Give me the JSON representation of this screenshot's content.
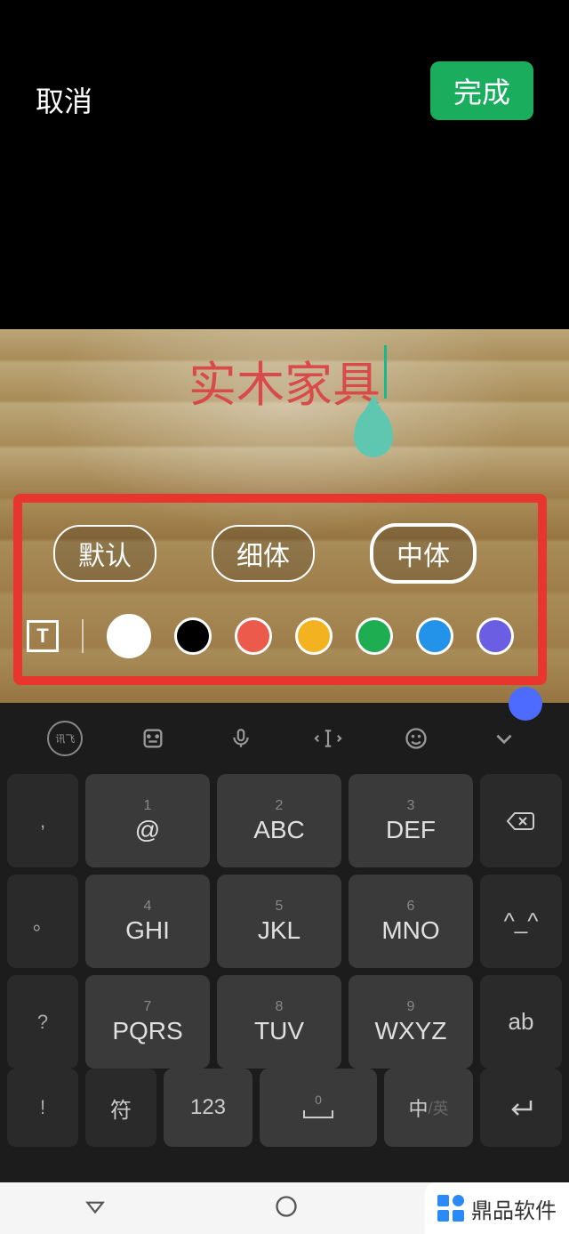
{
  "header": {
    "cancel": "取消",
    "done": "完成"
  },
  "canvas": {
    "text": "实木家具"
  },
  "fonts": {
    "default": "默认",
    "thin": "细体",
    "medium": "中体"
  },
  "colors": [
    {
      "name": "white",
      "hex": "#ffffff",
      "selected": true
    },
    {
      "name": "black",
      "hex": "#000000"
    },
    {
      "name": "red",
      "hex": "#ec5a4b"
    },
    {
      "name": "yellow",
      "hex": "#f3b320"
    },
    {
      "name": "green",
      "hex": "#1fad52"
    },
    {
      "name": "blue",
      "hex": "#2293e8"
    },
    {
      "name": "purple",
      "hex": "#6c5ee3"
    }
  ],
  "text_icon": "T",
  "keyboard": {
    "toolbar": {
      "ime": "讯飞",
      "clipboard": "clipboard",
      "mic": "mic",
      "cursor": "cursor",
      "emoji": "emoji",
      "collapse": "collapse"
    },
    "side": [
      ", ",
      "。",
      "?",
      "!"
    ],
    "keys": [
      {
        "num": "1",
        "label": "@"
      },
      {
        "num": "2",
        "label": "ABC"
      },
      {
        "num": "3",
        "label": "DEF"
      },
      {
        "num": "4",
        "label": "GHI"
      },
      {
        "num": "5",
        "label": "JKL"
      },
      {
        "num": "6",
        "label": "MNO"
      },
      {
        "num": "7",
        "label": "PQRS"
      },
      {
        "num": "8",
        "label": "TUV"
      },
      {
        "num": "9",
        "label": "WXYZ"
      }
    ],
    "right": {
      "backspace": "⌫",
      "emoticon": "^_^",
      "ab": "ab"
    },
    "bottom": {
      "symbol": "符",
      "num123": "123",
      "space_num": "0",
      "space_icon": "⌣",
      "lang_zh": "中",
      "lang_en": "/英",
      "enter": "↵"
    }
  },
  "watermark": "鼎品软件"
}
